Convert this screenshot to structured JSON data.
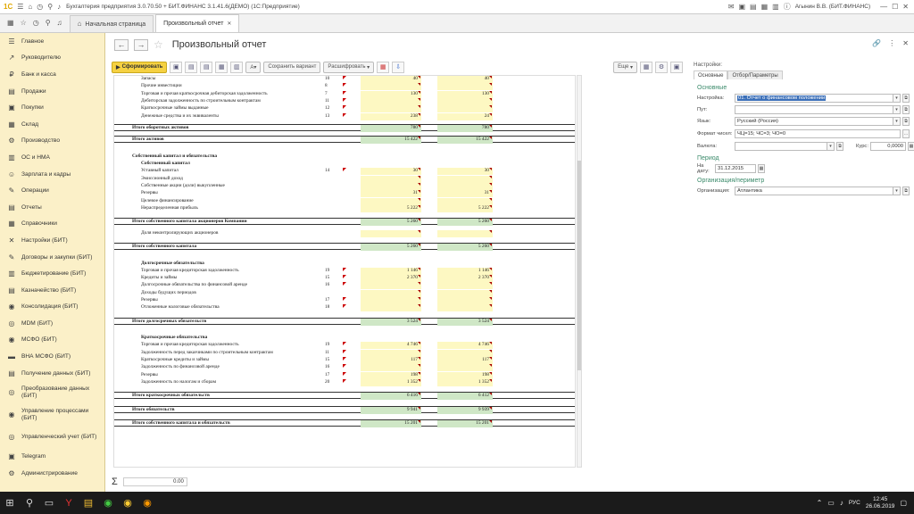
{
  "window": {
    "title": "Бухгалтерия предприятия 3.0.70.50 + БИТ.ФИНАНС 3.1.41.6(ДЕМО)  (1С:Предприятие)",
    "user": "Агынин В.В. (БИТ.ФИНАНС)"
  },
  "tabs": [
    {
      "label": "Начальная страница"
    },
    {
      "label": "Произвольный отчет"
    }
  ],
  "sidebar": {
    "items": [
      {
        "label": "Главное",
        "icon": "☰"
      },
      {
        "label": "Руководителю",
        "icon": "↗"
      },
      {
        "label": "Банк и касса",
        "icon": "₽"
      },
      {
        "label": "Продажи",
        "icon": "▤"
      },
      {
        "label": "Покупки",
        "icon": "▣"
      },
      {
        "label": "Склад",
        "icon": "▦"
      },
      {
        "label": "Производство",
        "icon": "⚙"
      },
      {
        "label": "ОС и НМА",
        "icon": "▥"
      },
      {
        "label": "Зарплата и кадры",
        "icon": "☺"
      },
      {
        "label": "Операции",
        "icon": "✎"
      },
      {
        "label": "Отчеты",
        "icon": "▤"
      },
      {
        "label": "Справочники",
        "icon": "▦"
      },
      {
        "label": "Настройки (БИТ)",
        "icon": "✕"
      },
      {
        "label": "Договоры и закупки (БИТ)",
        "icon": "✎"
      },
      {
        "label": "Бюджетирование (БИТ)",
        "icon": "▥"
      },
      {
        "label": "Казначейство (БИТ)",
        "icon": "▤"
      },
      {
        "label": "Консолидация (БИТ)",
        "icon": "◉"
      },
      {
        "label": "MDM (БИТ)",
        "icon": "◎"
      },
      {
        "label": "МСФО (БИТ)",
        "icon": "◉"
      },
      {
        "label": "ВНА МСФО (БИТ)",
        "icon": "▬"
      },
      {
        "label": "Получение данных (БИТ)",
        "icon": "▤"
      },
      {
        "label": "Преобразование данных (БИТ)",
        "icon": "◎"
      },
      {
        "label": "Управление процессами (БИТ)",
        "icon": "◉"
      },
      {
        "label": "Управленческий учет (БИТ)",
        "icon": "◎"
      },
      {
        "label": "Telegram",
        "icon": "▣"
      },
      {
        "label": "Администрирование",
        "icon": "⚙"
      }
    ]
  },
  "page": {
    "title": "Произвольный отчет"
  },
  "toolbar": {
    "form": "Сформировать",
    "save_variant": "Сохранить вариант",
    "decode": "Расшифровать",
    "more": "Еще"
  },
  "report": {
    "rows": [
      {
        "label": "Запасы",
        "code": "10",
        "v1": "40",
        "v2": "40",
        "type": "sub"
      },
      {
        "label": "Прочие инвестиции",
        "code": "8",
        "v1": "",
        "v2": "",
        "type": "sub"
      },
      {
        "label": "Торговая и прочая краткосрочная дебиторская задолженность",
        "code": "7",
        "v1": "130",
        "v2": "130",
        "type": "sub"
      },
      {
        "label": "Дебиторская задолженность по строительным контрактам",
        "code": "11",
        "v1": "",
        "v2": "",
        "type": "sub"
      },
      {
        "label": "Краткосрочные займы выданные",
        "code": "12",
        "v1": "",
        "v2": "",
        "type": "sub"
      },
      {
        "label": "Денежные средства и их эквиваленты",
        "code": "13",
        "v1": "238",
        "v2": "24",
        "type": "sub"
      },
      {
        "label": "Итого оборотных активов",
        "code": "",
        "v1": "780",
        "v2": "780",
        "type": "total"
      },
      {
        "label": "Итого активов",
        "code": "",
        "v1": "15 422",
        "v2": "15 422",
        "type": "total"
      },
      {
        "label": "Собственный капитал и обязательства",
        "code": "",
        "v1": "",
        "v2": "",
        "type": "head"
      },
      {
        "label": "Собственный капитал",
        "code": "",
        "v1": "",
        "v2": "",
        "type": "subhead"
      },
      {
        "label": "Уставный капитал",
        "code": "14",
        "v1": "30",
        "v2": "30",
        "type": "sub"
      },
      {
        "label": "Эмиссионный доход",
        "code": "",
        "v1": "",
        "v2": "",
        "type": "sub"
      },
      {
        "label": "Собственные акции (доли) выкупленные",
        "code": "",
        "v1": "",
        "v2": "",
        "type": "sub"
      },
      {
        "label": "Резервы",
        "code": "",
        "v1": "31",
        "v2": "31",
        "type": "sub"
      },
      {
        "label": "Целевое финансирование",
        "code": "",
        "v1": "",
        "v2": "",
        "type": "sub"
      },
      {
        "label": "Нераспределенная прибыль",
        "code": "",
        "v1": "5 222",
        "v2": "5 222",
        "type": "sub"
      },
      {
        "label": "Итого собственного капитала акционеров Компании",
        "code": "",
        "v1": "5 260",
        "v2": "5 260",
        "type": "total"
      },
      {
        "label": "Доля неконтролирующих акционеров",
        "code": "",
        "v1": "",
        "v2": "",
        "type": "sub"
      },
      {
        "label": "Итого собственного капитала",
        "code": "",
        "v1": "5 260",
        "v2": "5 260",
        "type": "total"
      },
      {
        "label": "Долгосрочные обязательства",
        "code": "",
        "v1": "",
        "v2": "",
        "type": "subhead"
      },
      {
        "label": "Торговая и прочая кредиторская задолженность",
        "code": "19",
        "v1": "1 146",
        "v2": "1 146",
        "type": "sub"
      },
      {
        "label": "Кредиты и займы",
        "code": "15",
        "v1": "2 370",
        "v2": "2 370",
        "type": "sub"
      },
      {
        "label": "Долгосрочные обязательства по финансовой аренде",
        "code": "16",
        "v1": "",
        "v2": "",
        "type": "sub"
      },
      {
        "label": "Доходы будущих периодов",
        "code": "",
        "v1": "",
        "v2": "",
        "type": "sub"
      },
      {
        "label": "Резервы",
        "code": "17",
        "v1": "",
        "v2": "",
        "type": "sub"
      },
      {
        "label": "Отложенные налоговые обязательства",
        "code": "18",
        "v1": "",
        "v2": "",
        "type": "sub"
      },
      {
        "label": "Итого долгосрочных обязательств",
        "code": "",
        "v1": "3 524",
        "v2": "3 524",
        "type": "total"
      },
      {
        "label": "Краткосрочные обязательства",
        "code": "",
        "v1": "",
        "v2": "",
        "type": "subhead"
      },
      {
        "label": "Торговая и прочая кредиторская задолженность",
        "code": "19",
        "v1": "4 746",
        "v2": "4 746",
        "type": "sub"
      },
      {
        "label": "Задолженность перед заказчиками по строительным контрактам",
        "code": "11",
        "v1": "",
        "v2": "",
        "type": "sub"
      },
      {
        "label": "Краткосрочные кредиты и займы",
        "code": "15",
        "v1": "117",
        "v2": "117",
        "type": "sub"
      },
      {
        "label": "Задолженность по финансовой аренде",
        "code": "16",
        "v1": "",
        "v2": "",
        "type": "sub"
      },
      {
        "label": "Резервы",
        "code": "17",
        "v1": "198",
        "v2": "198",
        "type": "sub"
      },
      {
        "label": "Задолженность по налогам и сборам",
        "code": "20",
        "v1": "1 352",
        "v2": "1 352",
        "type": "sub"
      },
      {
        "label": "Итого краткосрочных обязательств",
        "code": "",
        "v1": "6 416",
        "v2": "6 412",
        "type": "total"
      },
      {
        "label": "Итого обязательств",
        "code": "",
        "v1": "9 941",
        "v2": "9 939",
        "type": "total"
      },
      {
        "label": "Итого собственного капитала и обязательств",
        "code": "",
        "v1": "15 201",
        "v2": "15 201",
        "type": "total"
      }
    ]
  },
  "sum": {
    "symbol": "Σ",
    "value": "0.00"
  },
  "settings": {
    "panel_label": "Настройки:",
    "tabs": [
      "Основные",
      "Отбор/Параметры"
    ],
    "section_main": "Основные",
    "setting_label": "Настройка:",
    "setting_value": "01. Отчет о финансовом положении",
    "path_label": "Пут:",
    "lang_label": "Язык:",
    "lang_value": "Русский (Россия)",
    "format_label": "Формат чисел:",
    "format_value": "ЧЦ=15; ЧС=3; ЧО=0",
    "currency_label": "Валюта:",
    "rate_label": "Курс:",
    "rate_value": "0,0000",
    "section_period": "Период",
    "date_label": "На дату:",
    "date_value": "31.12.2015",
    "section_org": "Организация/периметр",
    "org_label": "Организация:",
    "org_value": "Атлантика"
  },
  "taskbar": {
    "lang": "РУС",
    "time": "12:45",
    "date": "26.06.2019"
  }
}
